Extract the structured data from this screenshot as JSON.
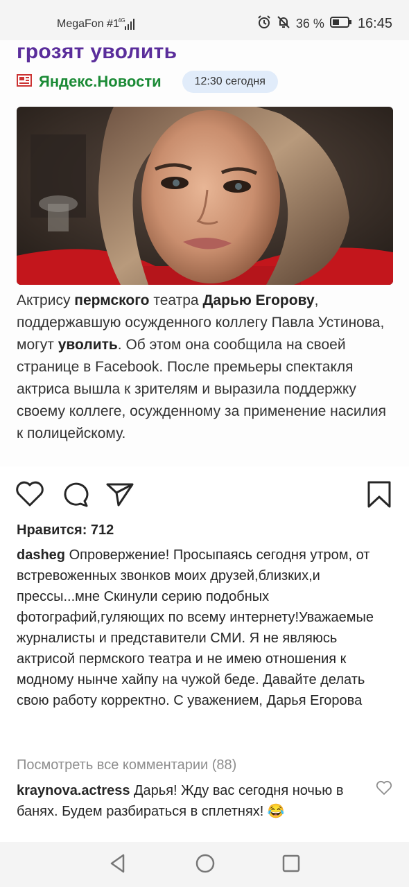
{
  "status_bar": {
    "carrier": "MegaFon #1",
    "network": "4G",
    "battery": "36 %",
    "time": "16:45"
  },
  "news_card": {
    "headline_part1": "грозят",
    "headline_part2": "уволить",
    "source_name": "Яндекс.Новости",
    "source_time": "12:30 сегодня",
    "article_seg1": "Актрису ",
    "article_bold1": "пермского",
    "article_seg2": " театра ",
    "article_bold2": "Дарью Егорову",
    "article_seg3": ", поддержавшую осужденного коллегу Павла Устинова, могут ",
    "article_bold3": "уволить",
    "article_seg4": ". Об этом она сообщила на своей странице в Facebook. После премьеры спектакля актриса вышла к зрителям и выразила поддержку своему коллеге, осужденному за применение насилия к полицейскому."
  },
  "post": {
    "likes_text": "Нравится: 712",
    "caption_user": "dasheg",
    "caption_text": " Опровержение! Просыпаясь сегодня утром, от встревоженных звонков моих друзей,близких,и прессы...мне Скинули серию подобных фотографий,гуляющих по всему интернету!Уважаемые журналисты и представители СМИ. Я не являюсь актрисой пермского театра и не имею отношения к модному нынче хайпу на чужой беде. Давайте делать свою работу корректно. С уважением, Дарья Егорова",
    "view_all_comments": "Посмотреть все комментарии (88)",
    "comment_user": "kraynova.actress",
    "comment_text": " Дарья! Жду вас сегодня ночью в банях. Будем разбираться в сплетнях! 😂"
  },
  "icons": {
    "like": "heart-icon",
    "comment": "comment-icon",
    "share": "send-icon",
    "save": "bookmark-icon",
    "nav_back": "back-triangle-icon",
    "nav_home": "home-circle-icon",
    "nav_recent": "recent-square-icon"
  },
  "colors": {
    "headline": "#5a2d9b",
    "source": "#1a8a35",
    "time_badge": "#e1ecfa",
    "muted": "#8e8e8e"
  }
}
